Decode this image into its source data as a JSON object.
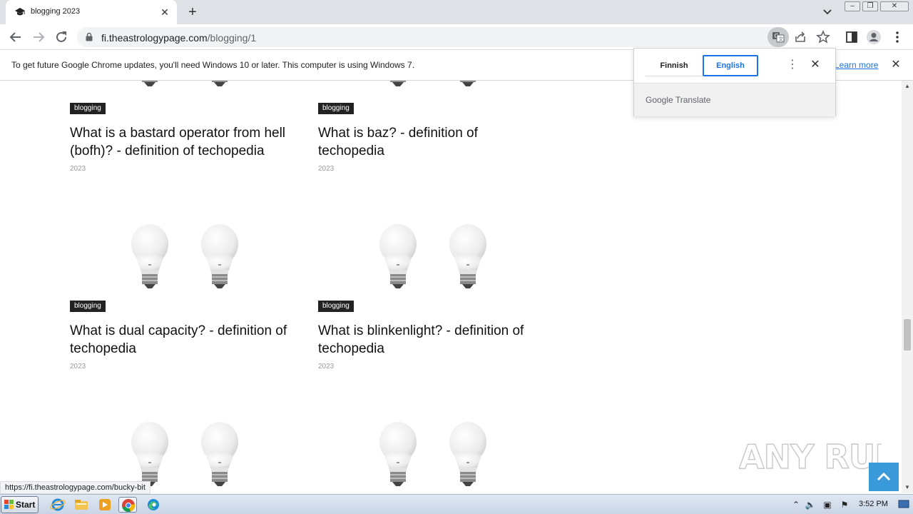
{
  "browser": {
    "tab": {
      "title": "blogging 2023",
      "favicon": "graduation-cap-icon",
      "close_icon": "close-icon"
    },
    "new_tab_label": "+",
    "window_controls": [
      "minimize",
      "restore",
      "close"
    ],
    "address": {
      "host": "fi.theastrologypage.com",
      "path": "/blogging/1"
    },
    "status_url": "https://fi.theastrologypage.com/bucky-bit"
  },
  "infobar": {
    "message": "To get future Google Chrome updates, you'll need Windows 10 or later. This computer is using Windows 7.",
    "link": "Learn more"
  },
  "translate_popup": {
    "source_lang": "Finnish",
    "target_lang": "English",
    "brand": "Google Translate",
    "accent": "#1a73e8"
  },
  "posts": [
    {
      "category": "blogging",
      "title": "What is a bastard operator from hell (bofh)? - definition of techopedia",
      "year": "2023"
    },
    {
      "category": "blogging",
      "title": "What is baz? - definition of techopedia",
      "year": "2023"
    },
    {
      "category": "blogging",
      "title": "What is dual capacity? - definition of techopedia",
      "year": "2023"
    },
    {
      "category": "blogging",
      "title": "What is blinkenlight? - definition of techopedia",
      "year": "2023"
    }
  ],
  "watermark": "ANY RUN",
  "back_to_top_color": "#3a9ad9",
  "taskbar": {
    "start_label": "Start",
    "apps": [
      "internet-explorer-icon",
      "file-explorer-icon",
      "media-player-icon",
      "chrome-icon",
      "edge-icon"
    ],
    "clock": "3:52 PM"
  }
}
